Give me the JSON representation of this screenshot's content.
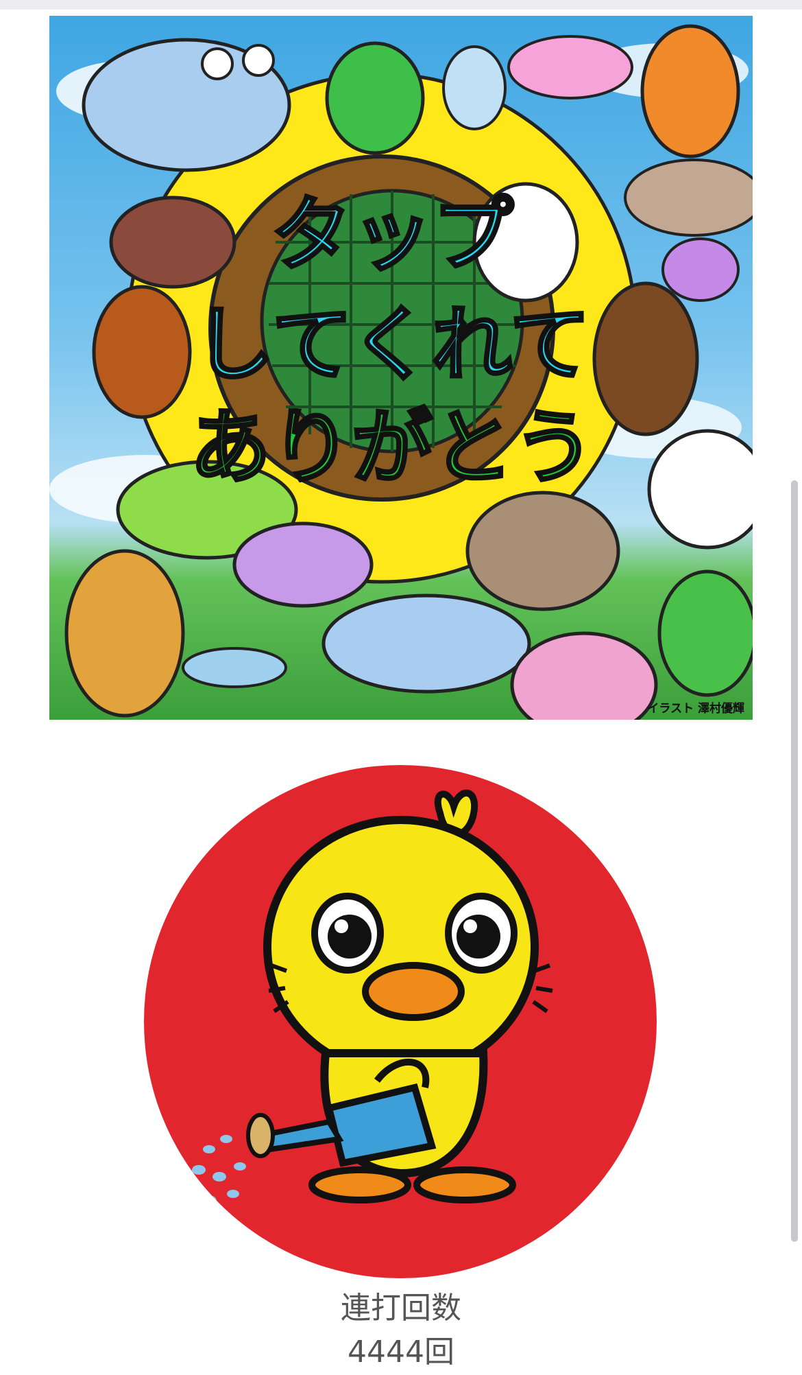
{
  "banner": {
    "title_line1": "タップ",
    "title_line2": "してくれて",
    "title_line3": "ありがとう",
    "credit": "イラスト 澤村優輝"
  },
  "tap_button": {
    "icon": "duck-watering-can-icon",
    "background_color": "#e2262e"
  },
  "counter": {
    "label": "連打回数",
    "value": "4444回"
  },
  "colors": {
    "title_cyan": "#27d8f0",
    "title_green": "#20c83a",
    "sunflower": "#ffe81a"
  }
}
